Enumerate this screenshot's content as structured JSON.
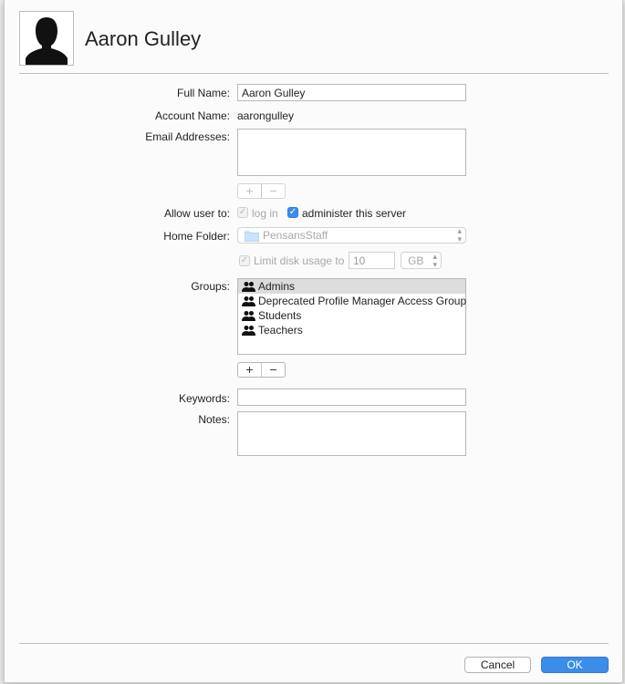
{
  "user": {
    "display_name": "Aaron Gulley"
  },
  "form": {
    "full_name_label": "Full Name:",
    "full_name_value": "Aaron Gulley",
    "account_name_label": "Account Name:",
    "account_name_value": "aarongulley",
    "email_label": "Email Addresses:",
    "email_value": "",
    "plus": "+",
    "minus": "−",
    "allow_label": "Allow user to:",
    "login_label": "log in",
    "login_checked": true,
    "login_enabled": false,
    "admin_label": "administer this server",
    "admin_checked": true,
    "home_folder_label": "Home Folder:",
    "home_folder_value": "PensansStaff",
    "limit_label": "Limit disk usage to",
    "limit_checked": true,
    "limit_value": "10",
    "limit_unit": "GB",
    "groups_label": "Groups:",
    "groups": [
      "Admins",
      "Deprecated Profile Manager Access Group",
      "Students",
      "Teachers"
    ],
    "selected_group": "Admins",
    "keywords_label": "Keywords:",
    "keywords_value": "",
    "notes_label": "Notes:",
    "notes_value": ""
  },
  "buttons": {
    "cancel": "Cancel",
    "ok": "OK"
  },
  "colors": {
    "accent": "#3b8de9",
    "sheet_bg": "#fbfbfb",
    "window_bg": "#ececec"
  }
}
